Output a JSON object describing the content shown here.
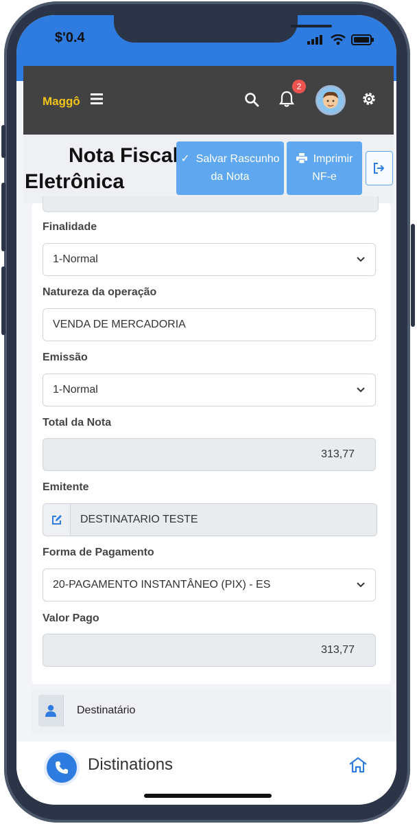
{
  "status_bar": {
    "time": "$'0.4"
  },
  "topbar": {
    "logo": "Maggô",
    "notification_count": "2"
  },
  "header": {
    "title_line1": "Nota Fiscal",
    "title_line2": "Eletrônica",
    "save_line1": "Salvar Rascunho",
    "save_line2": "da Nota",
    "print_line1": "Imprimir",
    "print_line2": "NF-e"
  },
  "form": {
    "finalidade": {
      "label": "Finalidade",
      "value": "1-Normal"
    },
    "natureza": {
      "label": "Natureza da operação",
      "value": "VENDA DE MERCADORIA"
    },
    "emissao": {
      "label": "Emissão",
      "value": "1-Normal"
    },
    "total": {
      "label": "Total da Nota",
      "value": "313,77"
    },
    "emitente": {
      "label": "Emitente",
      "value": "DESTINATARIO TESTE"
    },
    "pagamento": {
      "label": "Forma de Pagamento",
      "value": "20-PAGAMENTO INSTANTÂNEO (PIX) - ES"
    },
    "valor_pago": {
      "label": "Valor Pago",
      "value": "313,77"
    }
  },
  "destinatario": {
    "label": "Destinatário"
  },
  "bottom_nav": {
    "label": "Distinations"
  },
  "icons": [
    "menu-icon",
    "search-icon",
    "bell-icon",
    "avatar",
    "gear-icon",
    "check-icon",
    "printer-icon",
    "logout-icon",
    "chevron-down-icon",
    "edit-icon",
    "user-icon",
    "phone-icon",
    "home-icon"
  ],
  "colors": {
    "accent": "#2f7ce0",
    "button": "#5fa8ef",
    "topbar": "#424242",
    "logo": "#f2c318",
    "badge": "#ef5350"
  }
}
